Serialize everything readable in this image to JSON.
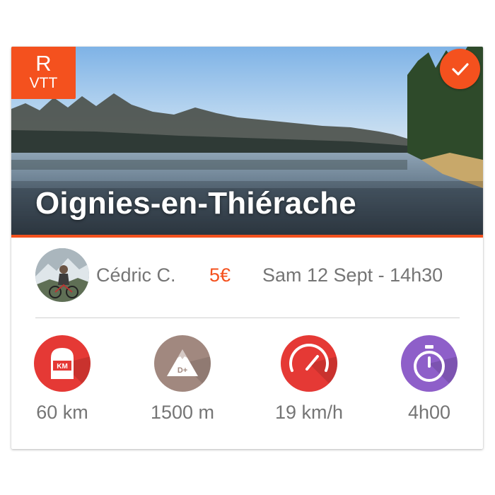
{
  "ride": {
    "level": "R",
    "type": "VTT",
    "title": "Oignies-en-Thiérache",
    "completed": true
  },
  "organizer": {
    "name": "Cédric C."
  },
  "price": "5€",
  "date": "Sam 12 Sept - 14h30",
  "stats": [
    {
      "icon": "distance-km-icon",
      "icon_text": "KM",
      "value": "60 km",
      "color": "#e53935"
    },
    {
      "icon": "elevation-icon",
      "icon_text": "D+",
      "value": "1500 m",
      "color": "#a1887f"
    },
    {
      "icon": "speedometer-icon",
      "icon_text": "",
      "value": "19 km/h",
      "color": "#e53935"
    },
    {
      "icon": "stopwatch-icon",
      "icon_text": "",
      "value": "4h00",
      "color": "#8e5fc9"
    }
  ],
  "colors": {
    "accent": "#f4511e",
    "text_secondary": "#757575"
  }
}
